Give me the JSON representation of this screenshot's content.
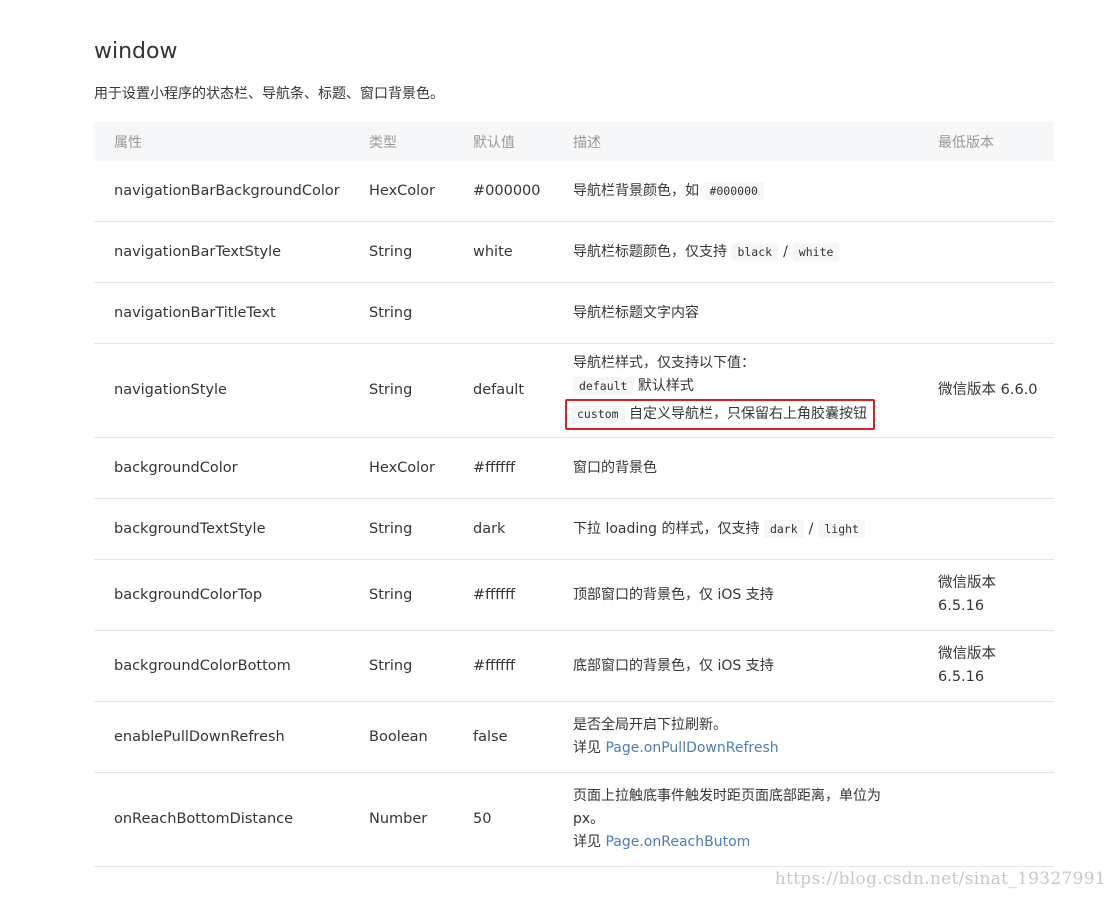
{
  "title": "window",
  "subtitle": "用于设置小程序的状态栏、导航条、标题、窗口背景色。",
  "table": {
    "headers": {
      "attr": "属性",
      "type": "类型",
      "default": "默认值",
      "desc": "描述",
      "version": "最低版本"
    },
    "rows": [
      {
        "attr": "navigationBarBackgroundColor",
        "type": "HexColor",
        "default": "#000000",
        "desc_text": "导航栏背景颜色，如",
        "desc_code": "#000000",
        "version": ""
      },
      {
        "attr": "navigationBarTextStyle",
        "type": "String",
        "default": "white",
        "desc_text": "导航栏标题颜色，仅支持",
        "desc_code1": "black",
        "desc_sep": "/",
        "desc_code2": "white",
        "version": ""
      },
      {
        "attr": "navigationBarTitleText",
        "type": "String",
        "default": "",
        "desc_text": "导航栏标题文字内容",
        "version": ""
      },
      {
        "attr": "navigationStyle",
        "type": "String",
        "default": "default",
        "desc_line1": "导航栏样式，仅支持以下值：",
        "desc_code1": "default",
        "desc_text1": "默认样式",
        "desc_code2": "custom",
        "desc_text2": "自定义导航栏，只保留右上角胶囊按钮",
        "version": "微信版本 6.6.0"
      },
      {
        "attr": "backgroundColor",
        "type": "HexColor",
        "default": "#ffffff",
        "desc_text": "窗口的背景色",
        "version": ""
      },
      {
        "attr": "backgroundTextStyle",
        "type": "String",
        "default": "dark",
        "desc_text": "下拉 loading 的样式，仅支持",
        "desc_code1": "dark",
        "desc_sep": "/",
        "desc_code2": "light",
        "version": ""
      },
      {
        "attr": "backgroundColorTop",
        "type": "String",
        "default": "#ffffff",
        "desc_text": "顶部窗口的背景色，仅 iOS 支持",
        "version_line1": "微信版本",
        "version_line2": "6.5.16"
      },
      {
        "attr": "backgroundColorBottom",
        "type": "String",
        "default": "#ffffff",
        "desc_text": "底部窗口的背景色，仅 iOS 支持",
        "version_line1": "微信版本",
        "version_line2": "6.5.16"
      },
      {
        "attr": "enablePullDownRefresh",
        "type": "Boolean",
        "default": "false",
        "desc_line1": "是否全局开启下拉刷新。",
        "desc_see": "详见",
        "desc_link": "Page.onPullDownRefresh",
        "version": ""
      },
      {
        "attr": "onReachBottomDistance",
        "type": "Number",
        "default": "50",
        "desc_line1": "页面上拉触底事件触发时距页面底部距离，单位为",
        "desc_line2": "px。",
        "desc_see": "详见",
        "desc_link": "Page.onReachButom",
        "version": ""
      }
    ]
  },
  "watermark": "https://blog.csdn.net/sinat_19327991",
  "colors": {
    "header_bg": "#f6f7f8",
    "link": "#4a7fb5",
    "highlight_border": "#e02020"
  }
}
